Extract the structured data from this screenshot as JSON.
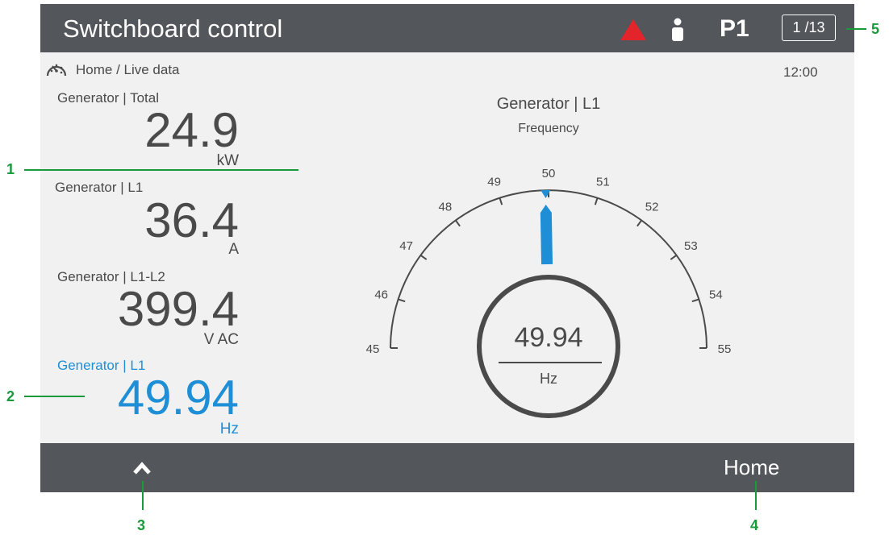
{
  "header": {
    "title": "Switchboard control",
    "profile": "P1",
    "page_indicator": "1 /13",
    "alarm_icon": "warning-triangle-icon",
    "user_icon": "user-icon",
    "colors": {
      "bar": "#53565b",
      "alarm": "#e3242b"
    }
  },
  "breadcrumb": {
    "text": "Home / Live data",
    "icon": "gauge-icon"
  },
  "clock": "12:00",
  "readings": [
    {
      "label": "Generator | Total",
      "value": "24.9",
      "unit": "kW"
    },
    {
      "label": "Generator | L1",
      "value": "36.4",
      "unit": "A"
    },
    {
      "label": "Generator | L1-L2",
      "value": "399.4",
      "unit": "V AC"
    },
    {
      "label": "Generator | L1",
      "value": "49.94",
      "unit": "Hz",
      "selected": true
    }
  ],
  "gauge": {
    "title": "Generator | L1",
    "subtitle": "Frequency",
    "min": 45,
    "max": 55,
    "ticks": [
      "45",
      "46",
      "47",
      "48",
      "49",
      "50",
      "51",
      "52",
      "53",
      "54",
      "55"
    ],
    "value": 49.94,
    "value_text": "49.94",
    "unit": "Hz",
    "accent": "#1e8fd6"
  },
  "footer": {
    "up_icon": "chevron-up-icon",
    "home_label": "Home"
  },
  "callouts": [
    "1",
    "2",
    "3",
    "4",
    "5"
  ]
}
